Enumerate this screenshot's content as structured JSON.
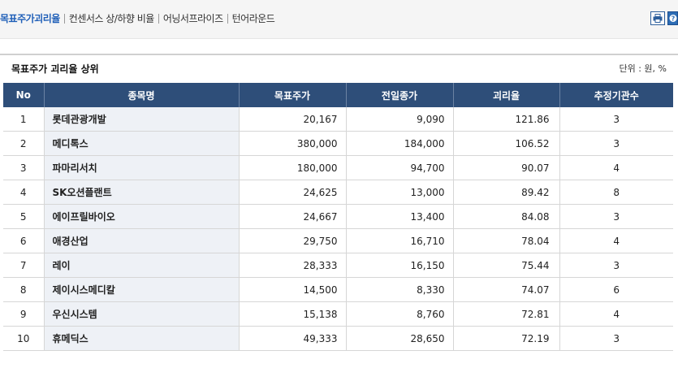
{
  "nav": {
    "tabs": [
      {
        "label": "목표주가괴리율"
      },
      {
        "label": "컨센서스 상/하향 비율"
      },
      {
        "label": "어닝서프라이즈"
      },
      {
        "label": "턴어라운드"
      }
    ]
  },
  "section": {
    "title": "목표주가 괴리율 상위",
    "unit": "단위 : 원, %"
  },
  "table": {
    "headers": [
      "No",
      "종목명",
      "목표주가",
      "전일종가",
      "괴리율",
      "추정기관수"
    ],
    "rows": [
      {
        "no": "1",
        "name": "롯데관광개발",
        "target": "20,167",
        "prev_close": "9,090",
        "gap": "121.86",
        "count": "3"
      },
      {
        "no": "2",
        "name": "메디톡스",
        "target": "380,000",
        "prev_close": "184,000",
        "gap": "106.52",
        "count": "3"
      },
      {
        "no": "3",
        "name": "파마리서치",
        "target": "180,000",
        "prev_close": "94,700",
        "gap": "90.07",
        "count": "4"
      },
      {
        "no": "4",
        "name": "SK오션플랜트",
        "target": "24,625",
        "prev_close": "13,000",
        "gap": "89.42",
        "count": "8"
      },
      {
        "no": "5",
        "name": "에이프릴바이오",
        "target": "24,667",
        "prev_close": "13,400",
        "gap": "84.08",
        "count": "3"
      },
      {
        "no": "6",
        "name": "애경산업",
        "target": "29,750",
        "prev_close": "16,710",
        "gap": "78.04",
        "count": "4"
      },
      {
        "no": "7",
        "name": "레이",
        "target": "28,333",
        "prev_close": "16,150",
        "gap": "75.44",
        "count": "3"
      },
      {
        "no": "8",
        "name": "제이시스메디칼",
        "target": "14,500",
        "prev_close": "8,330",
        "gap": "74.07",
        "count": "6"
      },
      {
        "no": "9",
        "name": "우신시스템",
        "target": "15,138",
        "prev_close": "8,760",
        "gap": "72.81",
        "count": "4"
      },
      {
        "no": "10",
        "name": "휴메딕스",
        "target": "49,333",
        "prev_close": "28,650",
        "gap": "72.19",
        "count": "3"
      }
    ]
  },
  "icons": {
    "print": "print-icon",
    "help": "help-icon"
  }
}
